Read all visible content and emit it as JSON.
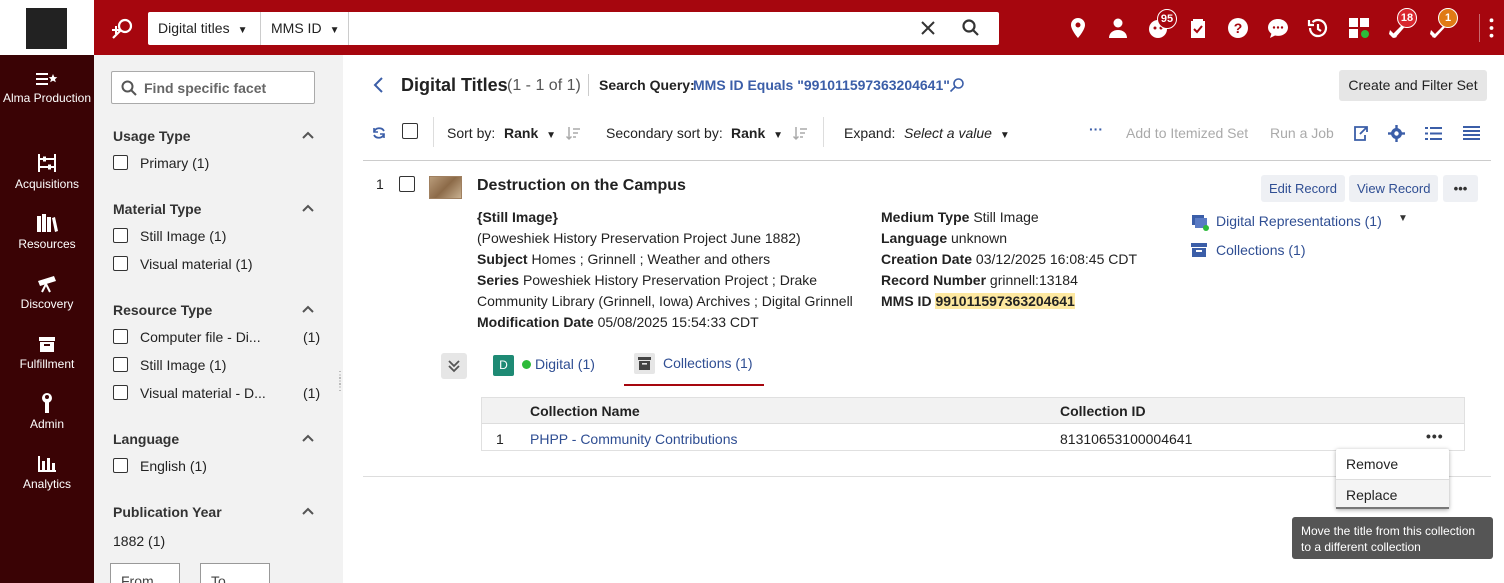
{
  "topbar": {
    "search_scope": "Digital titles",
    "search_field": "MMS ID",
    "search_value": "",
    "badges": {
      "tasks": "95",
      "notifications": "18",
      "alerts": "1"
    },
    "colors": {
      "brand": "#a6060e",
      "nav_bg": "#3a0305",
      "link": "#2f4e93"
    }
  },
  "nav": {
    "items": [
      {
        "label": "Alma Production",
        "icon": "alma-star-icon"
      },
      {
        "label": "Acquisitions",
        "icon": "abacus-icon"
      },
      {
        "label": "Resources",
        "icon": "books-icon"
      },
      {
        "label": "Discovery",
        "icon": "telescope-icon"
      },
      {
        "label": "Fulfillment",
        "icon": "box-icon"
      },
      {
        "label": "Admin",
        "icon": "wrench-icon"
      },
      {
        "label": "Analytics",
        "icon": "bar-chart-icon"
      }
    ]
  },
  "facets": {
    "search_placeholder": "Find specific facet",
    "groups": [
      {
        "title": "Usage Type",
        "options": [
          {
            "label": "Primary",
            "count": "(1)"
          }
        ]
      },
      {
        "title": "Material Type",
        "options": [
          {
            "label": "Still Image",
            "count": "(1)"
          },
          {
            "label": "Visual material",
            "count": "(1)"
          }
        ]
      },
      {
        "title": "Resource Type",
        "options": [
          {
            "label": "Computer file - Di...",
            "count": "(1)"
          },
          {
            "label": "Still Image",
            "count": "(1)"
          },
          {
            "label": "Visual material - D...",
            "count": "(1)"
          }
        ]
      },
      {
        "title": "Language",
        "options": [
          {
            "label": "English",
            "count": "(1)"
          }
        ]
      },
      {
        "title": "Publication Year",
        "options": [
          {
            "label": "1882",
            "count": "(1)"
          }
        ]
      }
    ],
    "year_from_placeholder": "From",
    "year_to_placeholder": "To",
    "year_dash": "–"
  },
  "header": {
    "title": "Digital Titles",
    "count": "(1 - 1 of 1)",
    "search_query_label": "Search Query:",
    "search_query_value": "MMS ID Equals \"991011597363204641\"",
    "create_set_label": "Create and Filter Set"
  },
  "toolbar": {
    "sort_label": "Sort by:",
    "sort_value": "Rank",
    "secondary_sort_label": "Secondary sort by:",
    "secondary_sort_value": "Rank",
    "expand_label": "Expand:",
    "expand_value": "Select a value",
    "more": "···",
    "add_itemized": "Add to Itemized Set",
    "run_job": "Run a Job"
  },
  "result": {
    "number": "1",
    "title": "Destruction on the Campus",
    "edit_record": "Edit Record",
    "view_record": "View Record",
    "more": "•••",
    "left_meta": {
      "type": "{Still Image}",
      "note": "(Poweshiek History Preservation Project June 1882)",
      "subject_label": "Subject",
      "subject_value": "Homes ; Grinnell ; Weather and others",
      "series_label": "Series",
      "series_value_1": "Poweshiek History Preservation Project ; Drake",
      "series_value_2": "Community Library (Grinnell, Iowa) Archives ; Digital Grinnell",
      "modification_label": "Modification Date",
      "modification_value": "05/08/2025 15:54:33 CDT"
    },
    "right_meta": {
      "medium_label": "Medium Type",
      "medium_value": "Still Image",
      "language_label": "Language",
      "language_value": "unknown",
      "creation_label": "Creation Date",
      "creation_value": "03/12/2025 16:08:45 CDT",
      "record_number_label": "Record Number",
      "record_number_value": "grinnell:13184",
      "mms_label": "MMS ID",
      "mms_value": "991011597363204641"
    },
    "links": {
      "digital_representations": "Digital Representations (1)",
      "collections": "Collections (1)"
    },
    "tabs": {
      "digital_badge": "D",
      "digital": "Digital (1)",
      "collections": "Collections (1)"
    },
    "table": {
      "headers": {
        "name": "Collection Name",
        "id": "Collection ID"
      },
      "rows": [
        {
          "num": "1",
          "name": "PHPP - Community Contributions",
          "id": "81310653100004641"
        }
      ],
      "row_more": "•••"
    },
    "menu": {
      "remove": "Remove",
      "replace": "Replace"
    },
    "tooltip": "Move the title from this collection to a different collection"
  }
}
